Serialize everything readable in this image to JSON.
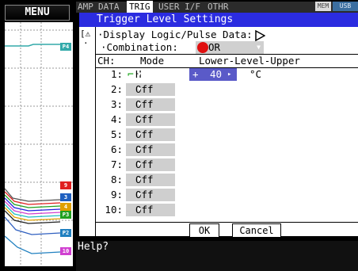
{
  "menu": {
    "label": "MENU"
  },
  "tabs": [
    {
      "label": "AMP"
    },
    {
      "label": "DATA"
    },
    {
      "label": "TRIG"
    },
    {
      "label": "USER I/F"
    },
    {
      "label": "OTHR"
    }
  ],
  "status": {
    "mem": "MEM",
    "usb": "USB"
  },
  "dialog": {
    "title": "Trigger Level Settings",
    "display_logic_label": "Display Logic/Pulse Data:",
    "combination_label": "Combination:",
    "combination_value": "OR",
    "columns": {
      "ch": "CH:",
      "mode": "Mode",
      "level": "Lower-Level-Upper"
    },
    "rows": [
      {
        "ch": "1:",
        "mode": "H",
        "level_value": "40",
        "unit": "°C"
      },
      {
        "ch": "2:",
        "mode": "Off"
      },
      {
        "ch": "3:",
        "mode": "Off"
      },
      {
        "ch": "4:",
        "mode": "Off"
      },
      {
        "ch": "5:",
        "mode": "Off"
      },
      {
        "ch": "6:",
        "mode": "Off"
      },
      {
        "ch": "7:",
        "mode": "Off"
      },
      {
        "ch": "8:",
        "mode": "Off"
      },
      {
        "ch": "9:",
        "mode": "Off"
      },
      {
        "ch": "10:",
        "mode": "Off"
      }
    ],
    "ok_label": "OK",
    "cancel_label": "Cancel"
  },
  "help": {
    "label": "Help?"
  },
  "side_tags": [
    "P4",
    "9",
    "3",
    "4",
    "P3",
    "P2",
    "10"
  ],
  "colors": {
    "title_bar": "#2b2ce0",
    "highlight": "#5a5ac8",
    "dropdown": "#cfcfcf"
  }
}
